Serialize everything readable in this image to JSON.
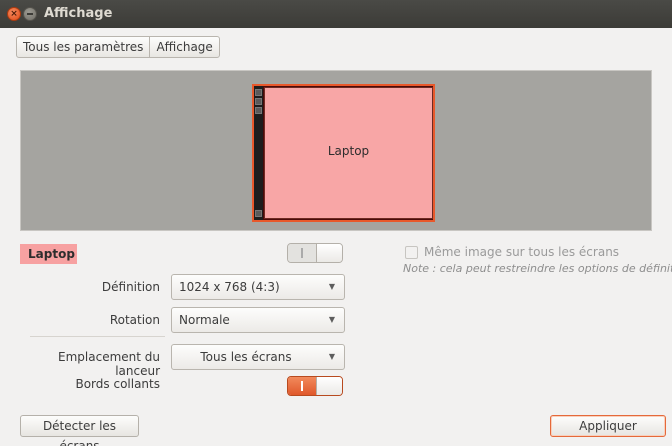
{
  "window": {
    "title": "Affichage"
  },
  "breadcrumb": {
    "all_settings": "Tous les paramètres",
    "current": "Affichage"
  },
  "monitor_preview": {
    "monitor_label": "Laptop"
  },
  "display": {
    "name": "Laptop",
    "enabled": true
  },
  "mirror": {
    "label": "Même image sur tous les écrans",
    "checked": false,
    "note": "Note : cela peut restreindre les options de définition"
  },
  "resolution": {
    "label": "Définition",
    "value": "1024 x 768 (4:3)"
  },
  "rotation": {
    "label": "Rotation",
    "value": "Normale"
  },
  "launcher": {
    "label": "Emplacement du lanceur",
    "value": "Tous les écrans"
  },
  "sticky_edges": {
    "label": "Bords collants",
    "enabled": true
  },
  "buttons": {
    "detect": "Détecter les écrans",
    "apply": "Appliquer"
  },
  "colors": {
    "accent": "#e8582b",
    "monitor_fill": "#f8a6a6",
    "canvas": "#a5a4a0"
  },
  "icons": {
    "close": "close-icon",
    "minimize": "minimize-icon",
    "dropdown": "chevron-down-icon"
  }
}
